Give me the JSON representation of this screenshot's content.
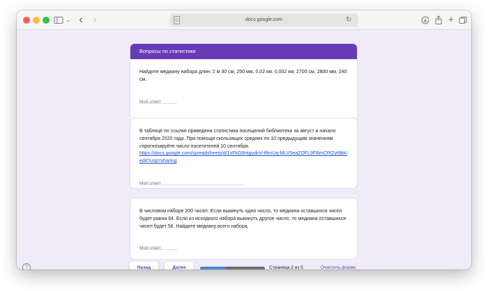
{
  "browser": {
    "url": "docs.google.com"
  },
  "form": {
    "section_title": "Вопросы по статистике",
    "questions": [
      {
        "text": "Найдите медиану набора длин:  2 м 30 см,  250 мм,  0,02 км,  0,002 км,  2700 см,  2800 мм,  240 см.",
        "answer_placeholder": "Мой ответ"
      },
      {
        "text": "В таблице по ссылке приведена статистика посещений библиотеки за август и начало сентября 2020 года. При помощи скользящих средних по 10 предыдущим значениям спрогнозируйте число посетителей 10 сентября.",
        "link": "https://docs.google.com/spreadsheets/d/1xFkG8HqjydnV-tftmUq-MLV5eaZOFL9FBmCRlZyt9bk/edit?usp=sharing",
        "answer_placeholder": "Мой ответ"
      },
      {
        "text": "В числовом наборе 200 чисел. Если выкинуть одно число, то медиана оставшихся чисел будет равна 64. Если из исходного набора выкинуть другое число, то медиана оставшихся чисел будет 56. Найдите медиану всего набора.",
        "answer_placeholder": "Мой ответ"
      }
    ]
  },
  "footer": {
    "back_label": "Назад",
    "next_label": "Далее",
    "page_label": "Страница 2 из 5",
    "progress_fraction": 0.4,
    "clear_label": "Очистить форму",
    "help_glyph": "?"
  },
  "colors": {
    "accent": "#673ab7",
    "background": "#f0ebf8",
    "progress_fill": "#4f85d9",
    "link": "#1a53d6"
  },
  "icons": [
    "sidebar-icon",
    "chevron-down-icon",
    "back-arrow-icon",
    "forward-arrow-icon",
    "page-icon",
    "reload-icon",
    "download-icon",
    "share-icon",
    "new-tab-icon",
    "tabs-overview-icon",
    "help-icon"
  ]
}
